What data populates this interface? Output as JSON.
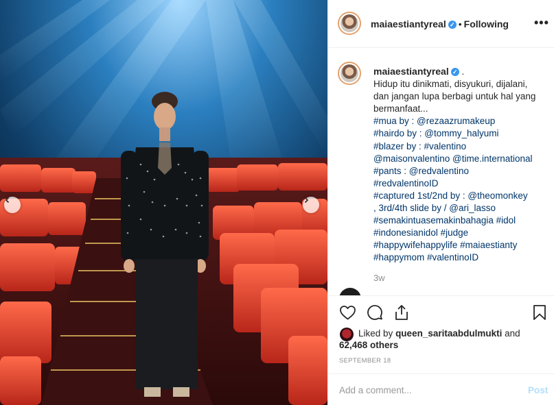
{
  "post": {
    "username": "maiaestiantyreal",
    "verified_icon": "verified-badge-icon",
    "separator": "•",
    "follow_status": "Following",
    "more_icon": "•••"
  },
  "caption": {
    "username": "maiaestiantyreal",
    "trailing": ".",
    "text": "Hidup itu dinikmati, disyukuri, dijalani, dan jangan lupa berbagi untuk hal yang bermanfaat...",
    "lines": [
      "#mua by : @rezaazrumakeup",
      "#hairdo by : @tommy_halyumi",
      "#blazer by : #valentino",
      "@maisonvalentino @time.international",
      "#pants : @redvalentino",
      "#redvalentinoID",
      "#captured 1st/2nd by : @theomonkey",
      ", 3rd/4th slide by / @ari_lasso",
      "#semakintuasemakinbahagia #idol",
      "#indonesianidol #judge",
      "#happywifehappylife #maiaestianty",
      "#happymom #valentinoID"
    ],
    "age": "3w"
  },
  "likes": {
    "prefix": "Liked by",
    "liker": "queen_sarita​abdulmukti",
    "conj": "and",
    "count": "62,468 others"
  },
  "date": "SEPTEMBER 18",
  "comment": {
    "placeholder": "Add a comment...",
    "post_label": "Post"
  },
  "colors": {
    "accent": "#3897f0",
    "link": "#003569",
    "muted": "#8e8e8e",
    "post_disabled": "#b2dffc"
  }
}
